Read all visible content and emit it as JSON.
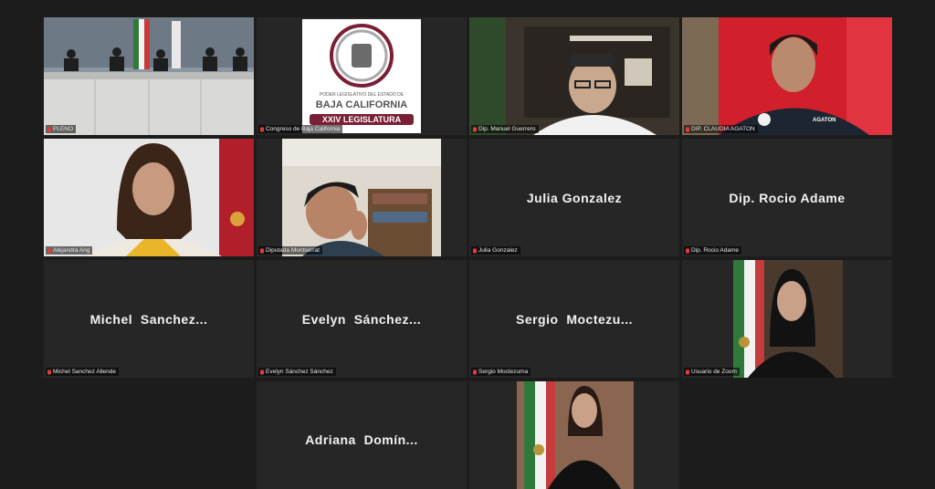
{
  "meeting": {
    "tiles": [
      {
        "id": "pleno",
        "label": "PLENO"
      },
      {
        "id": "congreso",
        "label": "Congreso de Baja California"
      },
      {
        "id": "manuel",
        "label": "Dip. Manuel Guerrero"
      },
      {
        "id": "claudia",
        "label": "DIP. CLAUDIA AGATON"
      },
      {
        "id": "alejandra",
        "label": "Alejandra Ang"
      },
      {
        "id": "diputada",
        "label": "Diputada Montserrat"
      },
      {
        "id": "julia",
        "name": "Julia Gonzalez",
        "label": "Julia Gonzalez"
      },
      {
        "id": "rocio",
        "name": "Dip. Rocio Adame",
        "label": "Dip. Rocio Adame"
      },
      {
        "id": "michel",
        "name": "Michel  Sanchez...",
        "label": "Michel Sanchez Allende"
      },
      {
        "id": "evelyn",
        "name": "Evelyn  Sánchez...",
        "label": "Evelyn Sánchez Sánchez"
      },
      {
        "id": "sergio",
        "name": "Sergio  Moctezu...",
        "label": "Sergio Moctezuma"
      },
      {
        "id": "zoom_user",
        "label": "Usuario de Zoom"
      },
      {
        "id": "adriana",
        "name": "Adriana  Domín..."
      },
      {
        "id": "portrait2"
      }
    ]
  },
  "congress_logo": {
    "line1": "PODER LEGISLATIVO DEL ESTADO DE",
    "line2": "BAJA CALIFORNIA",
    "line3": "XXIV LEGISLATURA",
    "accent": "#7a1f35"
  },
  "shirt_text": "AGATON",
  "colors": {
    "background": "#1c1c1c",
    "tile": "#262626",
    "active_speaker": "#b8d34a",
    "mic_off": "#e23b3b"
  }
}
